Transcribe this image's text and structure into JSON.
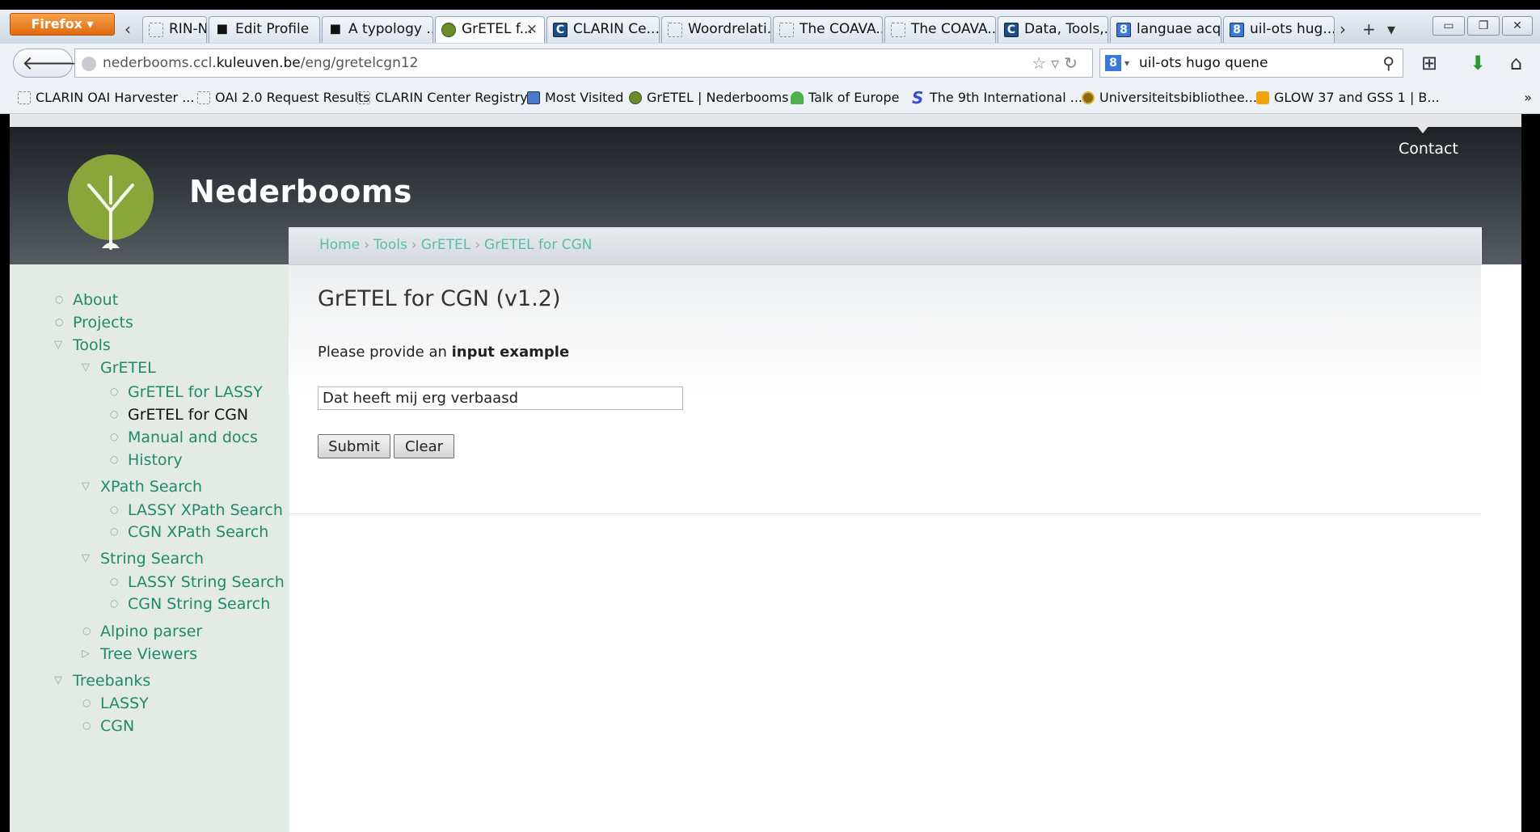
{
  "browser": {
    "menu_button": "Firefox ▾",
    "tabs": [
      {
        "title": "RIN-NL ...",
        "icon": "blank-page-icon"
      },
      {
        "title": "Edit Profile",
        "icon": "bookmark-logo-icon"
      },
      {
        "title": "A typology ...",
        "icon": "bookmark-logo-icon"
      },
      {
        "title": "GrETEL f...",
        "icon": "tree-logo-icon",
        "active": true
      },
      {
        "title": "CLARIN Ce...",
        "icon": "clarin-c-icon"
      },
      {
        "title": "Woordrelati...",
        "icon": "blank-page-icon"
      },
      {
        "title": "The COAVA...",
        "icon": "blank-page-icon"
      },
      {
        "title": "The COAVA...",
        "icon": "blank-page-icon"
      },
      {
        "title": "Data, Tools,...",
        "icon": "clarin-c-icon"
      },
      {
        "title": "languae acq...",
        "icon": "google-icon"
      },
      {
        "title": "uil-ots hug...",
        "icon": "google-icon"
      }
    ],
    "url": {
      "prefix": "nederbooms.ccl.",
      "domain": "kuleuven.be",
      "path": "/eng/gretelcgn12"
    },
    "search_query": "uil-ots hugo quene",
    "bookmarks": [
      {
        "label": "CLARIN OAI Harvester ...",
        "icon": "blank"
      },
      {
        "label": "OAI 2.0 Request Results",
        "icon": "blank"
      },
      {
        "label": "CLARIN Center Registry",
        "icon": "blank"
      },
      {
        "label": "Most Visited",
        "icon": "star"
      },
      {
        "label": "GrETEL | Nederbooms",
        "icon": "tree"
      },
      {
        "label": "Talk of Europe",
        "icon": "green"
      },
      {
        "label": "The 9th International ...",
        "icon": "s"
      },
      {
        "label": "Universiteitsbibliothee...",
        "icon": "gold"
      },
      {
        "label": "GLOW 37 and GSS 1 | B...",
        "icon": "orange"
      }
    ]
  },
  "site": {
    "name": "Nederbooms",
    "contact": "Contact",
    "breadcrumb": [
      "Home",
      "Tools",
      "GrETEL",
      "GrETEL for CGN"
    ],
    "breadcrumb_sep": "›"
  },
  "sidebar": {
    "about": "About",
    "projects": "Projects",
    "tools": "Tools",
    "gretel": "GrETEL",
    "gretel_lassy": "GrETEL for LASSY",
    "gretel_cgn": "GrETEL for CGN",
    "manual": "Manual and docs",
    "history": "History",
    "xpath_search": "XPath Search",
    "lassy_xpath": "LASSY XPath Search",
    "cgn_xpath": "CGN XPath Search",
    "string_search": "String Search",
    "lassy_string": "LASSY String Search",
    "cgn_string": "CGN String Search",
    "alpino": "Alpino parser",
    "tree_viewers": "Tree Viewers",
    "treebanks": "Treebanks",
    "lassy": "LASSY",
    "cgn": "CGN"
  },
  "main": {
    "title": "GrETEL for CGN (v1.2)",
    "instruction_prefix": "Please provide an ",
    "instruction_bold": "input example",
    "input_value": "Dat heeft mij erg verbaasd",
    "submit_label": "Submit",
    "clear_label": "Clear"
  },
  "colors": {
    "link": "#1f8a6a",
    "header_dark": "#3c4148",
    "sidebar_bg": "#e4ebe5",
    "firefox_orange": "#e06a10"
  }
}
